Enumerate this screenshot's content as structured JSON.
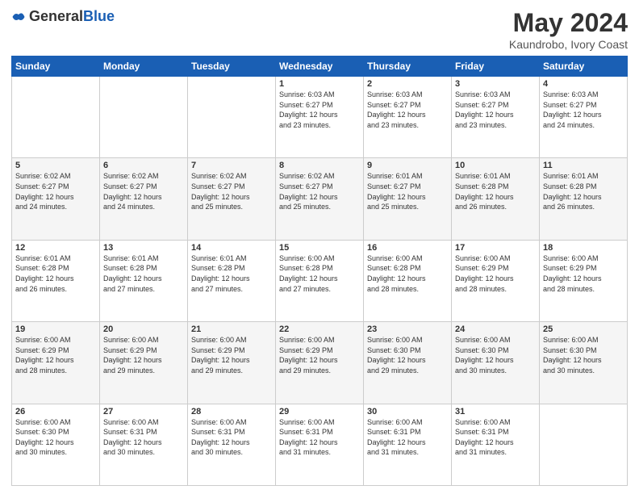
{
  "header": {
    "logo_general": "General",
    "logo_blue": "Blue",
    "title": "May 2024",
    "location": "Kaundrobo, Ivory Coast"
  },
  "days_of_week": [
    "Sunday",
    "Monday",
    "Tuesday",
    "Wednesday",
    "Thursday",
    "Friday",
    "Saturday"
  ],
  "weeks": [
    {
      "days": [
        {
          "num": "",
          "info": ""
        },
        {
          "num": "",
          "info": ""
        },
        {
          "num": "",
          "info": ""
        },
        {
          "num": "1",
          "info": "Sunrise: 6:03 AM\nSunset: 6:27 PM\nDaylight: 12 hours\nand 23 minutes."
        },
        {
          "num": "2",
          "info": "Sunrise: 6:03 AM\nSunset: 6:27 PM\nDaylight: 12 hours\nand 23 minutes."
        },
        {
          "num": "3",
          "info": "Sunrise: 6:03 AM\nSunset: 6:27 PM\nDaylight: 12 hours\nand 23 minutes."
        },
        {
          "num": "4",
          "info": "Sunrise: 6:03 AM\nSunset: 6:27 PM\nDaylight: 12 hours\nand 24 minutes."
        }
      ]
    },
    {
      "days": [
        {
          "num": "5",
          "info": "Sunrise: 6:02 AM\nSunset: 6:27 PM\nDaylight: 12 hours\nand 24 minutes."
        },
        {
          "num": "6",
          "info": "Sunrise: 6:02 AM\nSunset: 6:27 PM\nDaylight: 12 hours\nand 24 minutes."
        },
        {
          "num": "7",
          "info": "Sunrise: 6:02 AM\nSunset: 6:27 PM\nDaylight: 12 hours\nand 25 minutes."
        },
        {
          "num": "8",
          "info": "Sunrise: 6:02 AM\nSunset: 6:27 PM\nDaylight: 12 hours\nand 25 minutes."
        },
        {
          "num": "9",
          "info": "Sunrise: 6:01 AM\nSunset: 6:27 PM\nDaylight: 12 hours\nand 25 minutes."
        },
        {
          "num": "10",
          "info": "Sunrise: 6:01 AM\nSunset: 6:28 PM\nDaylight: 12 hours\nand 26 minutes."
        },
        {
          "num": "11",
          "info": "Sunrise: 6:01 AM\nSunset: 6:28 PM\nDaylight: 12 hours\nand 26 minutes."
        }
      ]
    },
    {
      "days": [
        {
          "num": "12",
          "info": "Sunrise: 6:01 AM\nSunset: 6:28 PM\nDaylight: 12 hours\nand 26 minutes."
        },
        {
          "num": "13",
          "info": "Sunrise: 6:01 AM\nSunset: 6:28 PM\nDaylight: 12 hours\nand 27 minutes."
        },
        {
          "num": "14",
          "info": "Sunrise: 6:01 AM\nSunset: 6:28 PM\nDaylight: 12 hours\nand 27 minutes."
        },
        {
          "num": "15",
          "info": "Sunrise: 6:00 AM\nSunset: 6:28 PM\nDaylight: 12 hours\nand 27 minutes."
        },
        {
          "num": "16",
          "info": "Sunrise: 6:00 AM\nSunset: 6:28 PM\nDaylight: 12 hours\nand 28 minutes."
        },
        {
          "num": "17",
          "info": "Sunrise: 6:00 AM\nSunset: 6:29 PM\nDaylight: 12 hours\nand 28 minutes."
        },
        {
          "num": "18",
          "info": "Sunrise: 6:00 AM\nSunset: 6:29 PM\nDaylight: 12 hours\nand 28 minutes."
        }
      ]
    },
    {
      "days": [
        {
          "num": "19",
          "info": "Sunrise: 6:00 AM\nSunset: 6:29 PM\nDaylight: 12 hours\nand 28 minutes."
        },
        {
          "num": "20",
          "info": "Sunrise: 6:00 AM\nSunset: 6:29 PM\nDaylight: 12 hours\nand 29 minutes."
        },
        {
          "num": "21",
          "info": "Sunrise: 6:00 AM\nSunset: 6:29 PM\nDaylight: 12 hours\nand 29 minutes."
        },
        {
          "num": "22",
          "info": "Sunrise: 6:00 AM\nSunset: 6:29 PM\nDaylight: 12 hours\nand 29 minutes."
        },
        {
          "num": "23",
          "info": "Sunrise: 6:00 AM\nSunset: 6:30 PM\nDaylight: 12 hours\nand 29 minutes."
        },
        {
          "num": "24",
          "info": "Sunrise: 6:00 AM\nSunset: 6:30 PM\nDaylight: 12 hours\nand 30 minutes."
        },
        {
          "num": "25",
          "info": "Sunrise: 6:00 AM\nSunset: 6:30 PM\nDaylight: 12 hours\nand 30 minutes."
        }
      ]
    },
    {
      "days": [
        {
          "num": "26",
          "info": "Sunrise: 6:00 AM\nSunset: 6:30 PM\nDaylight: 12 hours\nand 30 minutes."
        },
        {
          "num": "27",
          "info": "Sunrise: 6:00 AM\nSunset: 6:31 PM\nDaylight: 12 hours\nand 30 minutes."
        },
        {
          "num": "28",
          "info": "Sunrise: 6:00 AM\nSunset: 6:31 PM\nDaylight: 12 hours\nand 30 minutes."
        },
        {
          "num": "29",
          "info": "Sunrise: 6:00 AM\nSunset: 6:31 PM\nDaylight: 12 hours\nand 31 minutes."
        },
        {
          "num": "30",
          "info": "Sunrise: 6:00 AM\nSunset: 6:31 PM\nDaylight: 12 hours\nand 31 minutes."
        },
        {
          "num": "31",
          "info": "Sunrise: 6:00 AM\nSunset: 6:31 PM\nDaylight: 12 hours\nand 31 minutes."
        },
        {
          "num": "",
          "info": ""
        }
      ]
    }
  ]
}
